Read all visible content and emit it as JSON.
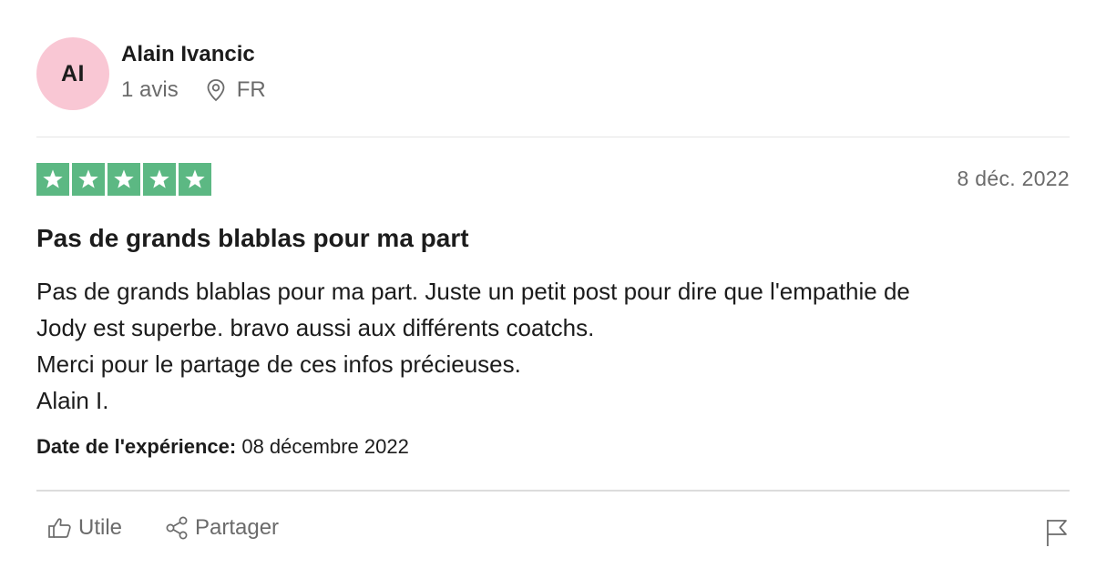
{
  "author": {
    "initials": "AI",
    "name": "Alain Ivancic",
    "reviews": "1 avis",
    "country": "FR",
    "avatar_color": "#f9c7d4"
  },
  "review": {
    "rating": 5,
    "rating_max": 5,
    "star_color": "#5cb883",
    "date": "8 déc. 2022",
    "title": "Pas de grands blablas pour ma part",
    "lines": [
      "Pas de grands blablas pour ma part. Juste un petit post pour dire que l'empathie de",
      "Jody est superbe. bravo aussi aux différents coatchs.",
      "Merci pour le partage de ces infos précieuses.",
      "Alain I."
    ],
    "experience_label": "Date de l'expérience:",
    "experience_date": "08 décembre 2022"
  },
  "actions": {
    "useful_label": "Utile",
    "share_label": "Partager",
    "useful_icon": "thumbs-up-icon",
    "share_icon": "share-icon",
    "flag_icon": "flag-icon"
  }
}
